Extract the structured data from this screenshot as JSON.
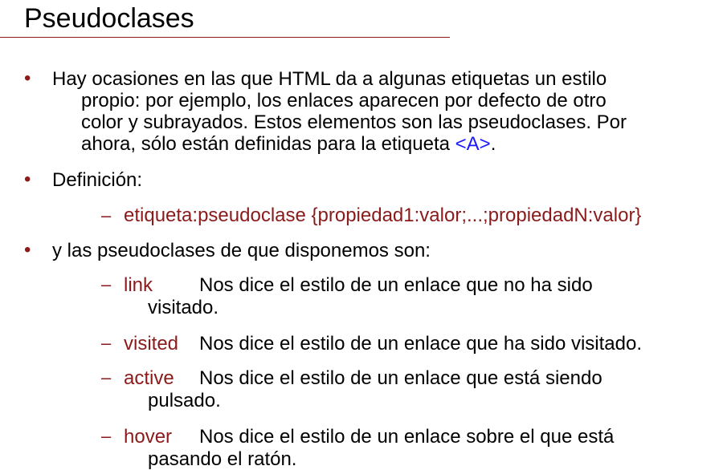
{
  "slide": {
    "title": "Pseudoclases",
    "bullet_char": "•",
    "dash_char": "–"
  },
  "intro": {
    "line1": "Hay ocasiones en las que HTML da a algunas etiquetas un estilo",
    "line2": "propio: por ejemplo, los enlaces aparecen por defecto de otro",
    "line3": "color y subrayados. Estos elementos son las pseudoclases. Por",
    "line4_prefix": "ahora, sólo están definidas para la etiqueta ",
    "line4_tag": "<A>",
    "line4_suffix": "."
  },
  "definition": {
    "label": "Definición:",
    "syntax": "etiqueta:pseudoclase {propiedad1:valor;...;propiedadN:valor}"
  },
  "pseudoclasses": {
    "intro": "y las pseudoclases de que disponemos son:",
    "items": [
      {
        "name": "link",
        "desc1": "Nos dice el estilo de un enlace que no ha sido",
        "desc2": "visitado."
      },
      {
        "name": "visited",
        "desc1": "Nos dice el estilo de un enlace que ha sido visitado.",
        "desc2": ""
      },
      {
        "name": "active",
        "desc1": "Nos dice el estilo de un enlace que está siendo",
        "desc2": "pulsado."
      },
      {
        "name": "hover",
        "desc1": "Nos dice el estilo de un enlace sobre el que está",
        "desc2": "pasando el ratón."
      }
    ]
  },
  "colors": {
    "accent": "#8b1a1a",
    "tag": "#1a1aff"
  }
}
